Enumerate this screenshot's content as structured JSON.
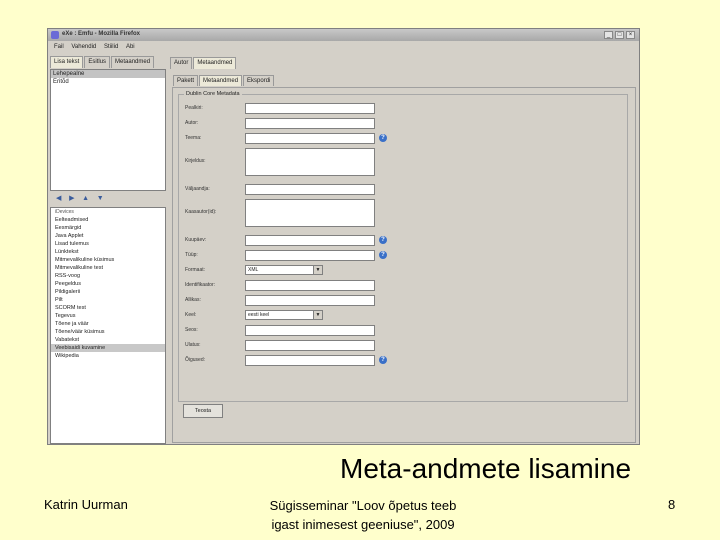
{
  "window": {
    "title": "eXe : Emfu - Mozilla Firefox",
    "buttons": [
      "_",
      "□",
      "×"
    ]
  },
  "menubar": [
    "Fail",
    "Vahendid",
    "Stiilid",
    "Abi"
  ],
  "left_tabs": [
    "Lisa tekst",
    "Esitlus",
    "Metaandmed"
  ],
  "tree": [
    "Lehepealne",
    "Eritõd"
  ],
  "list": {
    "header": "iDevices",
    "items": [
      "Eelteadmised",
      "Eesmärgid",
      "Java Applet",
      "Lisad tulemus",
      "Lünktekst",
      "Mitmevalikuline küsimus",
      "Mitmevalikuline test",
      "RSS-voog",
      "Peegeldus",
      "Pildigalerii",
      "Pilt",
      "SCORM test",
      "Tegevus",
      "Tõene ja väär",
      "Tõene/väär küsimus",
      "Vabatekst",
      "Veebisaidi kuvamine",
      "Wikipedia"
    ],
    "selected_index": 16
  },
  "right_top_tabs": [
    "Autor",
    "Metaandmed"
  ],
  "right_tabs": [
    "Pakett",
    "Metaandmed",
    "Ekspordi"
  ],
  "group_title": "Dublin Core Metadata",
  "fields": [
    {
      "label": "Pealkiri:",
      "type": "text",
      "help": false
    },
    {
      "label": "Autor:",
      "type": "text",
      "help": false
    },
    {
      "label": "Teema:",
      "type": "text",
      "help": true
    },
    {
      "label": "Kirjeldus:",
      "type": "textarea",
      "help": false
    },
    {
      "label": "Väljaandja:",
      "type": "text",
      "help": false
    },
    {
      "label": "Kaasautor(id):",
      "type": "textarea",
      "help": false
    },
    {
      "label": "Kuupäev:",
      "type": "text",
      "help": true
    },
    {
      "label": "Tüüp:",
      "type": "text",
      "help": true
    },
    {
      "label": "Formaat:",
      "type": "select",
      "value": "XML",
      "help": false
    },
    {
      "label": "Identifikaator:",
      "type": "text",
      "help": false
    },
    {
      "label": "Allikas:",
      "type": "text",
      "help": false
    },
    {
      "label": "Keel:",
      "type": "select",
      "value": "eesti keel",
      "help": false
    },
    {
      "label": "Seos:",
      "type": "text",
      "help": false
    },
    {
      "label": "Ulatus:",
      "type": "text",
      "help": false
    },
    {
      "label": "Õigused:",
      "type": "text",
      "help": true
    }
  ],
  "ok_button": "Teosta",
  "slide_title": "Meta-andmete lisamine",
  "footer": {
    "author": "Katrin Uurman",
    "center_line1": "Sügisseminar \"Loov õpetus teeb",
    "center_line2": "igast inimesest geeniuse\", 2009",
    "page": "8"
  }
}
